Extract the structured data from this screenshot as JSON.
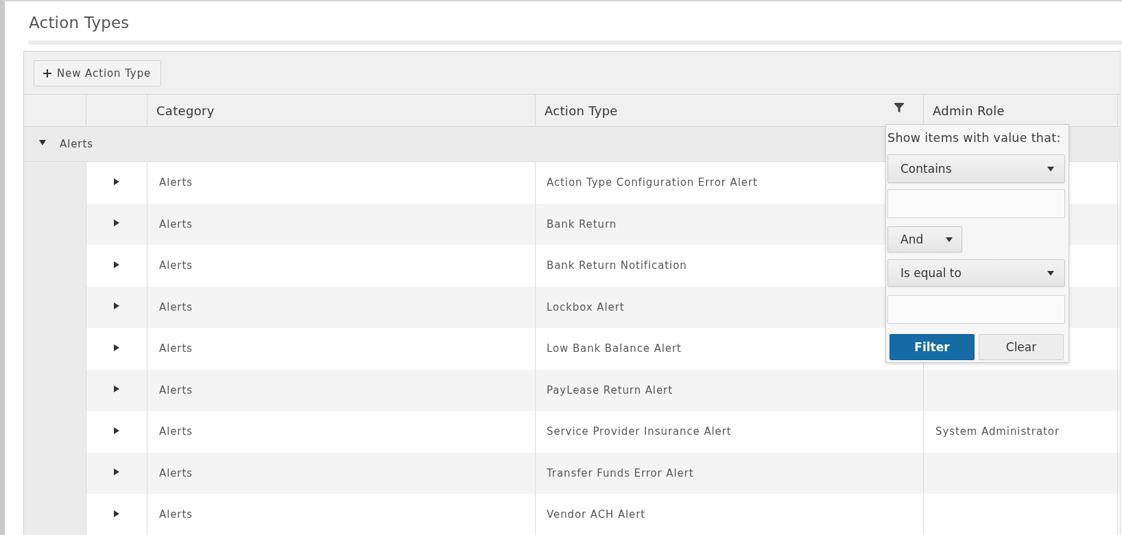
{
  "page": {
    "title": "Action Types"
  },
  "toolbar": {
    "buttons": [
      {
        "label": "New Action Type"
      }
    ]
  },
  "table": {
    "columns": [
      {
        "label": "Category",
        "filterable": false
      },
      {
        "label": "Action Type",
        "filterable": true
      },
      {
        "label": "Admin Role",
        "filterable": false
      }
    ],
    "groups": [
      {
        "label": "Alerts",
        "expanded": true,
        "rows": [
          {
            "cells": [
              "Alerts",
              "Action Type Configuration Error Alert"
            ],
            "expanded": false
          },
          {
            "cells": [
              "Alerts",
              "Bank Return"
            ],
            "expanded": false
          },
          {
            "cells": [
              "Alerts",
              "Bank Return Notification"
            ],
            "expanded": false
          },
          {
            "cells": [
              "Alerts",
              "Lockbox Alert"
            ],
            "expanded": false
          },
          {
            "cells": [
              "Alerts",
              "Low Bank Balance Alert"
            ],
            "expanded": false
          },
          {
            "cells": [
              "Alerts",
              "PayLease Return Alert"
            ],
            "expanded": false
          },
          {
            "cells": [
              "Alerts",
              "Service Provider Insurance Alert",
              "System Administrator"
            ],
            "expanded": false
          },
          {
            "cells": [
              "Alerts",
              "Transfer Funds Error Alert"
            ],
            "expanded": false
          },
          {
            "cells": [
              "Alerts",
              "Vendor ACH Alert"
            ],
            "expanded": false
          }
        ]
      }
    ]
  },
  "filter_menu": {
    "title": "Show items with value that:",
    "conditions": [
      {
        "operator": "Contains"
      },
      {
        "operator": "Is equal to"
      }
    ],
    "logic": "And",
    "buttons": [
      {
        "label": "Filter",
        "kind": "primary"
      },
      {
        "label": "Clear",
        "kind": "secondary"
      }
    ]
  }
}
